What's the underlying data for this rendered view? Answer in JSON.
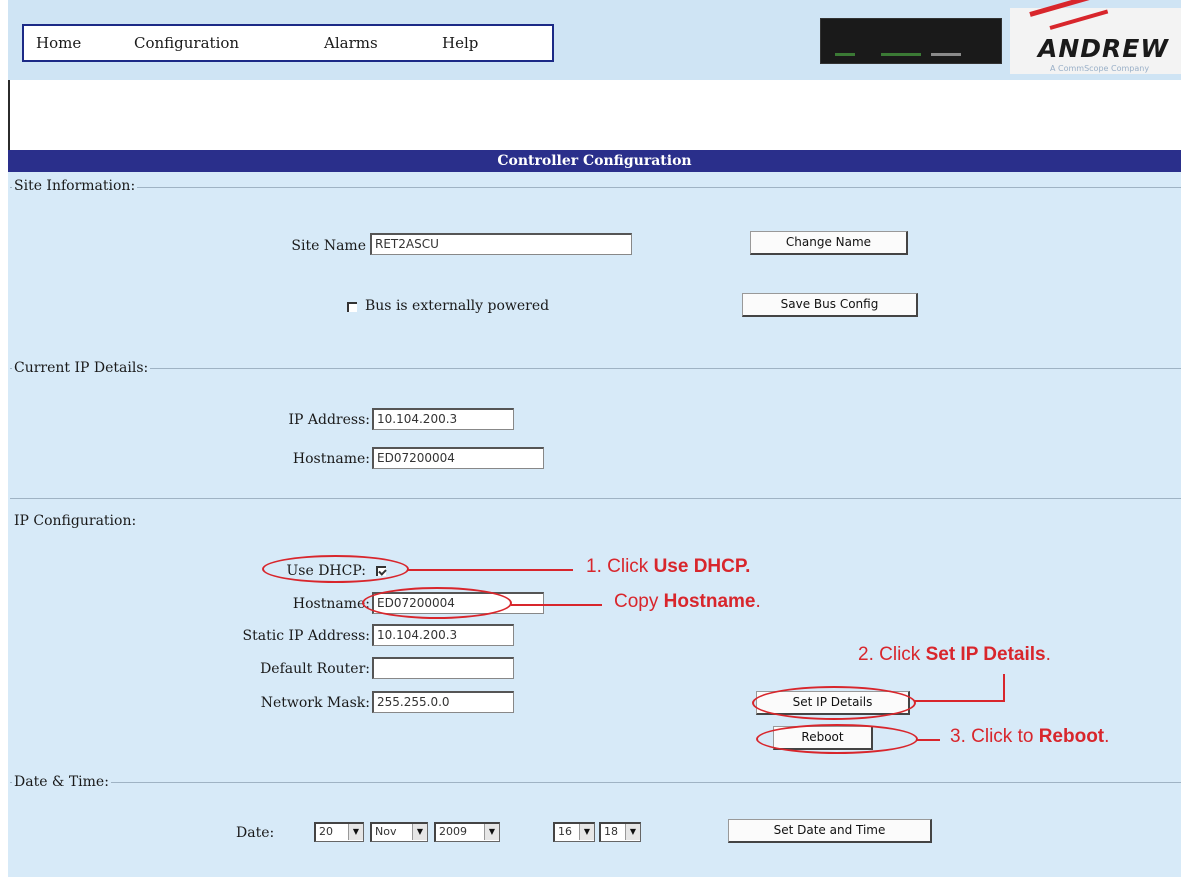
{
  "nav": {
    "items": [
      "Home",
      "Configuration",
      "Alarms",
      "Help"
    ]
  },
  "logo": {
    "brand": "ANDREW",
    "tagline": "A CommScope Company"
  },
  "page_title": "Controller Configuration",
  "site_info": {
    "legend": "Site Information:",
    "site_name_label": "Site Name",
    "site_name_value": "RET2ASCU",
    "change_name_button": "Change Name",
    "bus_powered_label": "Bus is externally powered",
    "bus_powered_checked": false,
    "save_bus_button": "Save Bus Config"
  },
  "current_ip": {
    "legend": "Current IP Details:",
    "ip_label": "IP Address:",
    "ip_value": "10.104.200.3",
    "hostname_label": "Hostname:",
    "hostname_value": "ED07200004"
  },
  "ip_config": {
    "legend": "IP Configuration:",
    "dhcp_label": "Use DHCP:",
    "dhcp_checked": true,
    "hostname_label": "Hostname:",
    "hostname_value": "ED07200004",
    "static_ip_label": "Static IP Address:",
    "static_ip_value": "10.104.200.3",
    "router_label": "Default Router:",
    "router_value": "",
    "mask_label": "Network Mask:",
    "mask_value": "255.255.0.0",
    "set_ip_button": "Set IP Details",
    "reboot_button": "Reboot"
  },
  "date_time": {
    "legend": "Date & Time:",
    "date_label": "Date:",
    "day": "20",
    "month": "Nov",
    "year": "2009",
    "hour": "16",
    "minute": "18",
    "set_button": "Set Date and Time"
  },
  "annotations": {
    "step1_prefix": "1. Click ",
    "step1_bold": "Use DHCP.",
    "copy_prefix": "Copy ",
    "copy_bold": "Hostname",
    "copy_suffix": ".",
    "step2_prefix": "2. Click ",
    "step2_bold": "Set IP Details",
    "step2_suffix": ".",
    "step3_prefix": "3. Click to ",
    "step3_bold": "Reboot",
    "step3_suffix": ".",
    "color": "#d8262c"
  },
  "colors": {
    "title_bar": "#2a2f8b",
    "panel": "#d7eaf8",
    "top_bar": "#cfe4f4"
  }
}
